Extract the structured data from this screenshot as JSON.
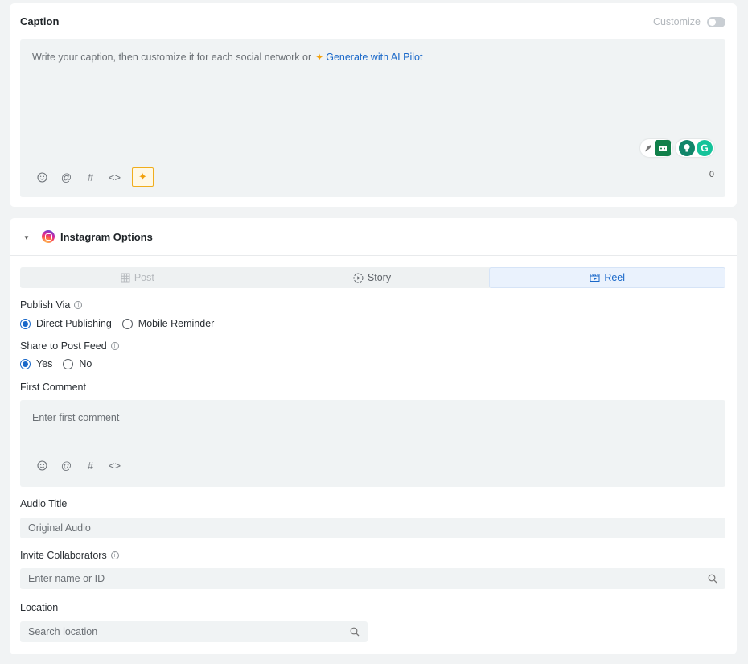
{
  "caption": {
    "title": "Caption",
    "customize_label": "Customize",
    "placeholder": "Write your caption, then customize it for each social network or",
    "ai_link": "Generate with AI Pilot",
    "char_count": "0",
    "toolbar_icons": [
      "emoji-icon",
      "mention-icon",
      "hashtag-icon",
      "code-icon",
      "ai-sparkle-icon"
    ]
  },
  "instagram": {
    "title": "Instagram Options",
    "tabs": [
      {
        "label": "Post",
        "state": "disabled"
      },
      {
        "label": "Story",
        "state": "normal"
      },
      {
        "label": "Reel",
        "state": "active"
      }
    ],
    "publish_via": {
      "label": "Publish Via",
      "options": [
        "Direct Publishing",
        "Mobile Reminder"
      ],
      "selected": "Direct Publishing"
    },
    "share_to_feed": {
      "label": "Share to Post Feed",
      "options": [
        "Yes",
        "No"
      ],
      "selected": "Yes"
    },
    "first_comment": {
      "label": "First Comment",
      "placeholder": "Enter first comment"
    },
    "audio_title": {
      "label": "Audio Title",
      "value": "Original Audio"
    },
    "invite_collaborators": {
      "label": "Invite Collaborators",
      "placeholder": "Enter name or ID"
    },
    "location": {
      "label": "Location",
      "placeholder": "Search location"
    }
  },
  "colors": {
    "accent": "#1a68c9",
    "ai": "#f2a10b",
    "editor_bg": "#f0f3f4"
  }
}
